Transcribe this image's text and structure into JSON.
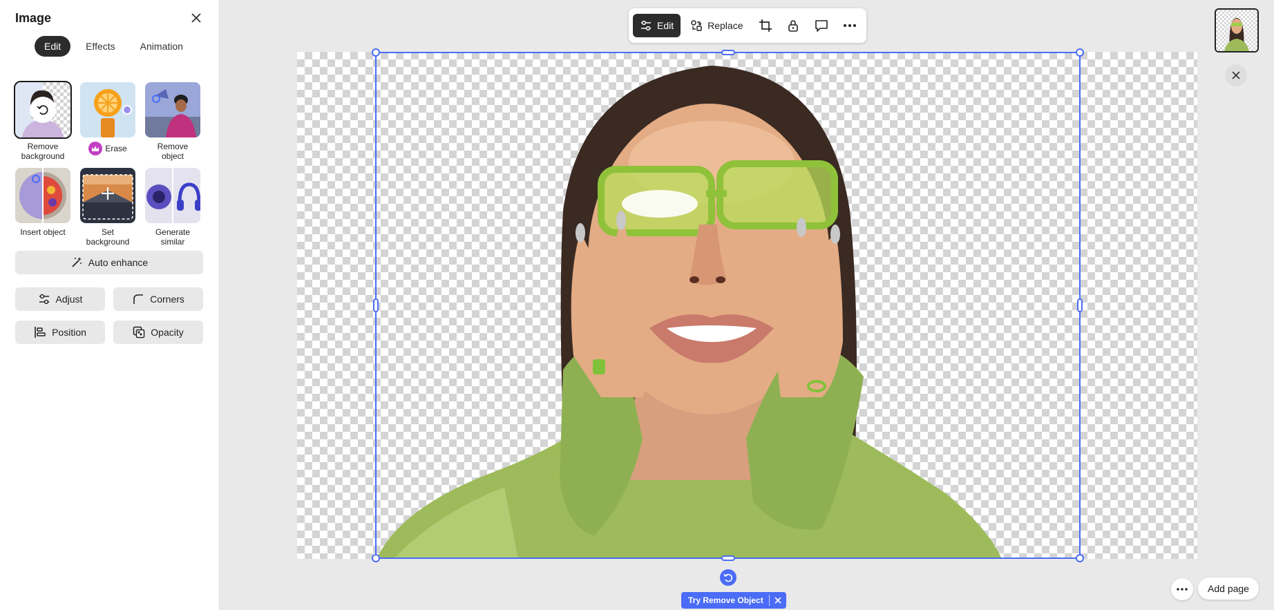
{
  "panel": {
    "title": "Image",
    "tabs": [
      {
        "label": "Edit",
        "active": true
      },
      {
        "label": "Effects",
        "active": false
      },
      {
        "label": "Animation",
        "active": false
      }
    ],
    "tools": [
      {
        "label": "Remove background",
        "icon": "undo-icon"
      },
      {
        "label": "Erase",
        "icon": "crown-icon",
        "premium": true
      },
      {
        "label": "Remove object"
      },
      {
        "label": "Insert object"
      },
      {
        "label": "Set background"
      },
      {
        "label": "Generate similar"
      }
    ],
    "auto_enhance": "Auto enhance",
    "adjust": "Adjust",
    "corners": "Corners",
    "position": "Position",
    "opacity": "Opacity"
  },
  "toolbar": {
    "edit": "Edit",
    "replace": "Replace"
  },
  "canvas": {
    "try_remove_object": "Try Remove Object"
  },
  "footer": {
    "add_page": "Add page"
  },
  "colors": {
    "accent": "#4a6cf7",
    "dark": "#2c2c2c",
    "premium": "#c23ec4",
    "hoodie": "#9dbb5a"
  }
}
